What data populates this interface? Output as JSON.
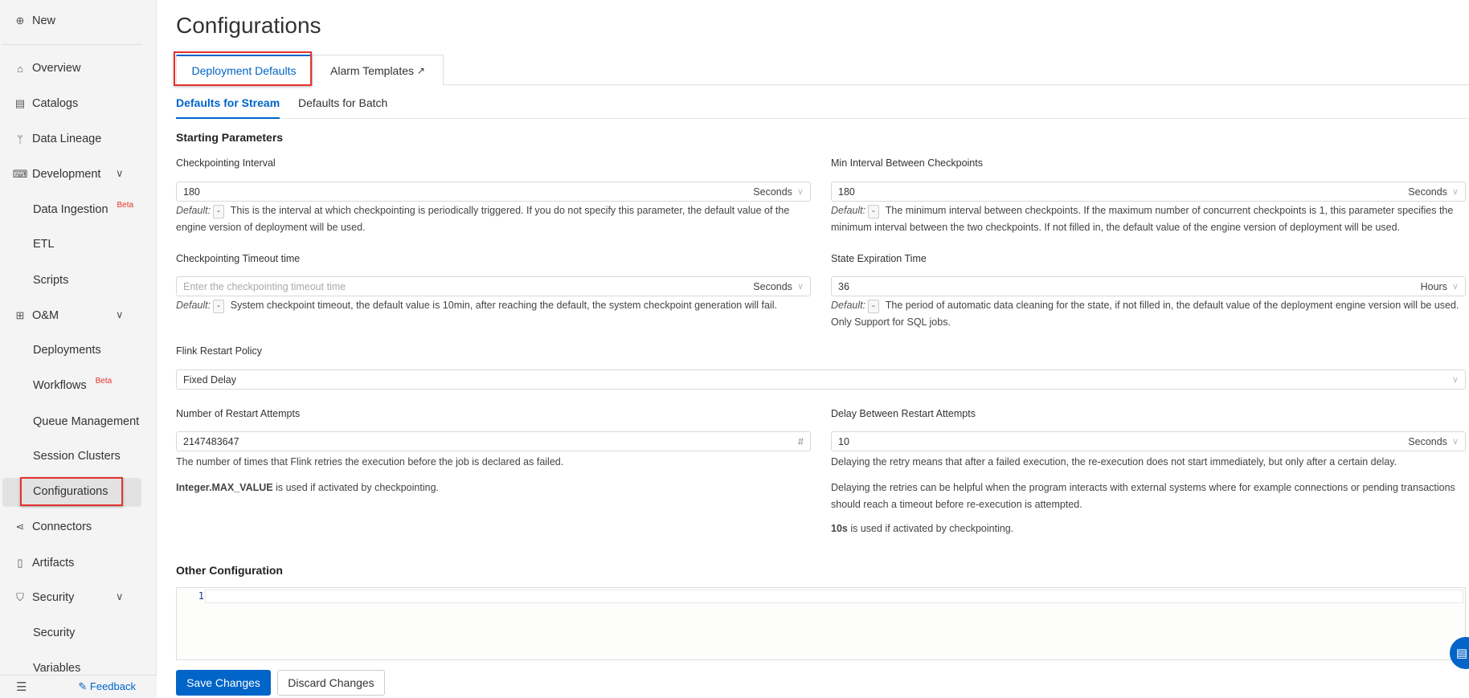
{
  "sidebar": {
    "new": "New",
    "items": [
      {
        "label": "Overview",
        "icon": "home-icon"
      },
      {
        "label": "Catalogs",
        "icon": "catalog-icon"
      },
      {
        "label": "Data Lineage",
        "icon": "branch-icon"
      },
      {
        "label": "Development",
        "icon": "terminal-icon"
      },
      {
        "label": "Data Ingestion",
        "badge": "Beta"
      },
      {
        "label": "ETL"
      },
      {
        "label": "Scripts"
      },
      {
        "label": "O&M",
        "icon": "ops-icon"
      },
      {
        "label": "Deployments"
      },
      {
        "label": "Workflows",
        "badge": "Beta"
      },
      {
        "label": "Queue Management"
      },
      {
        "label": "Session Clusters"
      },
      {
        "label": "Configurations",
        "active": true
      },
      {
        "label": "Connectors",
        "icon": "share-icon"
      },
      {
        "label": "Artifacts",
        "icon": "file-icon"
      },
      {
        "label": "Security",
        "icon": "shield-icon"
      },
      {
        "label": "Security"
      },
      {
        "label": "Variables"
      }
    ],
    "feedback": "Feedback"
  },
  "page": {
    "title": "Configurations"
  },
  "tabs": [
    "Deployment Defaults",
    "Alarm Templates"
  ],
  "subtabs": [
    "Defaults for Stream",
    "Defaults for Batch"
  ],
  "section": "Starting Parameters",
  "default_label": "Default:",
  "default_value": "-",
  "fields": {
    "checkpoint_interval": {
      "label": "Checkpointing Interval",
      "value": "180",
      "unit": "Seconds",
      "help": "This is the interval at which checkpointing is periodically triggered. If you do not specify this parameter, the default value of the engine version of deployment will be used."
    },
    "min_interval": {
      "label": "Min Interval Between Checkpoints",
      "value": "180",
      "unit": "Seconds",
      "help": "The minimum interval between checkpoints. If the maximum number of concurrent checkpoints is 1, this parameter specifies the minimum interval between the two checkpoints. If not filled in, the default value of the engine version of deployment will be used."
    },
    "checkpoint_timeout": {
      "label": "Checkpointing Timeout time",
      "placeholder": "Enter the checkpointing timeout time",
      "unit": "Seconds",
      "help": "System checkpoint timeout, the default value is 10min, after reaching the default, the system checkpoint generation will fail."
    },
    "state_expiration": {
      "label": "State Expiration Time",
      "value": "36",
      "unit": "Hours",
      "help": "The period of automatic data cleaning for the state, if not filled in, the default value of the deployment engine version will be used. Only Support for SQL jobs."
    },
    "restart_policy": {
      "label": "Flink Restart Policy",
      "value": "Fixed Delay"
    },
    "restart_attempts": {
      "label": "Number of Restart Attempts",
      "value": "2147483647",
      "help1": "The number of times that Flink retries the execution before the job is declared as failed.",
      "help2_bold": "Integer.MAX_VALUE",
      "help2": " is used if activated by checkpointing."
    },
    "restart_delay": {
      "label": "Delay Between Restart Attempts",
      "value": "10",
      "unit": "Seconds",
      "help1": "Delaying the retry means that after a failed execution, the re-execution does not start immediately, but only after a certain delay.",
      "help2": "Delaying the retries can be helpful when the program interacts with external systems where for example connections or pending transactions should reach a timeout before re-execution is attempted.",
      "help3_bold": "10s",
      "help3": " is used if activated by checkpointing."
    }
  },
  "other": {
    "title": "Other Configuration",
    "line_number": "1"
  },
  "buttons": {
    "save": "Save Changes",
    "discard": "Discard Changes"
  },
  "colors": {
    "accent": "#0064c8",
    "highlight": "#e5322d",
    "beta": "#e5322d"
  }
}
